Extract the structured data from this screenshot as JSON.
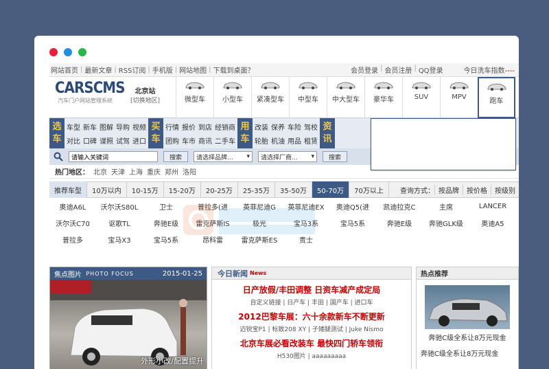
{
  "topbar": {
    "links": [
      "网站首页",
      "最新文章",
      "RSS订阅",
      "手机版",
      "网站地图",
      "下载到桌面？"
    ],
    "user_links": [
      "会员登录",
      "会员注册",
      "QQ登录"
    ],
    "weather_label": "今日洗车指数",
    "weather_value": "----"
  },
  "header": {
    "logo": "CARSCMS",
    "logo_sub": "汽车门户网站管理系统",
    "city": "北京站",
    "city_switch": "[切换地区]",
    "car_types": [
      "微型车",
      "小型车",
      "紧凑型车",
      "中型车",
      "中大型车",
      "豪华车",
      "SUV",
      "MPV",
      "跑车"
    ],
    "active_type": "跑车"
  },
  "nav": {
    "groups": [
      {
        "head": [
          "选",
          "车"
        ],
        "rows": [
          [
            "车型",
            "新车",
            "图解",
            "导购",
            "视频"
          ],
          [
            "对比",
            "口碑",
            "谍照",
            "试驾",
            "进口"
          ]
        ]
      },
      {
        "head": [
          "买",
          "车"
        ],
        "rows": [
          [
            "行情",
            "报价",
            "到店",
            "经销商"
          ],
          [
            "团购",
            "车市",
            "商讯",
            "二手车"
          ]
        ]
      },
      {
        "head": [
          "用",
          "车"
        ],
        "rows": [
          [
            "改装",
            "保养",
            "车险",
            "驾校"
          ],
          [
            "轮胎",
            "机油",
            "用品",
            "租赁"
          ]
        ]
      },
      {
        "head": [
          "资",
          "讯"
        ],
        "rows": [
          [],
          []
        ]
      }
    ]
  },
  "search": {
    "placeholder": "请输入关键词",
    "button": "搜索",
    "brand_select": "请选择品牌...",
    "maker_select": "请选择厂商...",
    "button2": "搜索"
  },
  "hot_areas": {
    "label": "热门地区：",
    "cities": [
      "北京",
      "天津",
      "上海",
      "重庆",
      "郑州",
      "洛阳"
    ]
  },
  "price_bar": {
    "tabs": [
      "推荐车型",
      "10万以内",
      "10-15万",
      "15-20万",
      "20-25万",
      "25-35万",
      "35-50万",
      "50-70万",
      "70万以上"
    ],
    "active": "50-70万",
    "mode_label": "查询方式：",
    "modes": [
      "按品牌",
      "按价格",
      "按级别"
    ]
  },
  "models": [
    [
      "奥迪A6L",
      "沃尔沃S80L",
      "卫士",
      "普拉多(进",
      "英菲尼迪G",
      "英菲尼迪EX",
      "奥迪Q5(进",
      "凯迪拉克C",
      "主席",
      "LANCER"
    ],
    [
      "沃尔沃C70",
      "讴歌TL",
      "奔驰E级",
      "雷克萨斯IS",
      "极光",
      "宝马3系",
      "宝马5系",
      "奔驰E级",
      "奔驰GLK级",
      "奥迪A5"
    ],
    [
      "普拉多",
      "宝马X3",
      "宝马5系",
      "昂科雷",
      "雷克萨斯ES",
      "贵士"
    ]
  ],
  "focus": {
    "title": "焦点图片",
    "title_en": "PHOTO FOCUS",
    "date": "2015-01-25",
    "caption": "外形小改/配置提升"
  },
  "news": {
    "title": "今日新闻",
    "title_en": "News",
    "items": [
      {
        "title": "日产放假/丰田调整 日资车减产成定局",
        "subs": "自定义链接 | 日产车 | 丰田 | 国产车 | 进口车"
      },
      {
        "title": "2012巴黎车展：六十余款新车不断更新",
        "subs": "迈锐宝P1 | 标致208 XY | 子矮腿测试 | Juke Nismo"
      },
      {
        "title": "北京车展必看改装车 最快四门轿车领衔",
        "subs": "H530图片 | aaaaaaaaa"
      }
    ]
  },
  "hot": {
    "title": "热点推荐",
    "caption": "奔驰C级全系让8万元现金",
    "caption2": "奔驰C级全系让8万元现金"
  },
  "colors": {
    "accent": "#3d5a86",
    "news_red": "#cc0000",
    "background": "#4a5d7e"
  }
}
